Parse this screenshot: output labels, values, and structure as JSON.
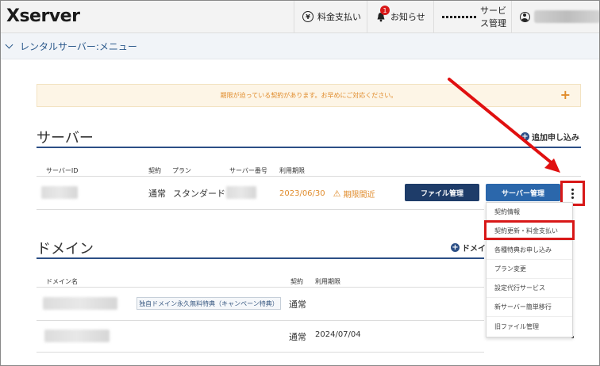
{
  "header": {
    "logo": "Xserver",
    "billing": "料金支払い",
    "notifications": "お知らせ",
    "notifications_badge": "1",
    "services": "サービス管理"
  },
  "menubar": {
    "label": "レンタルサーバー:メニュー"
  },
  "notice": {
    "text": "期限が迫っている契約があります。お早めにご対応ください。",
    "plus": "+"
  },
  "server": {
    "title": "サーバー",
    "add_link": "追加申し込み",
    "columns": [
      "サーバーID",
      "契約",
      "プラン",
      "サーバー番号",
      "利用期限"
    ],
    "row": {
      "contract": "通常",
      "plan": "スタンダード",
      "date": "2023/06/30",
      "warning": "期限間近",
      "file_btn": "ファイル管理",
      "server_btn": "サーバー管理"
    }
  },
  "dropdown": {
    "items": [
      "契約情報",
      "契約更新・料金支払い",
      "各種特典お申し込み",
      "プラン変更",
      "設定代行サービス",
      "新サーバー簡単移行",
      "旧ファイル管理"
    ]
  },
  "domain": {
    "title": "ドメイン",
    "add_link": "ドメイ",
    "columns": [
      "ドメイン名",
      "契約",
      "利用期限"
    ],
    "rows": [
      {
        "tag": "独自ドメイン永久無料特典（キャンペーン特典）",
        "contract": "通常",
        "date": ""
      },
      {
        "contract": "通常",
        "date": "2024/07/04"
      }
    ]
  },
  "colors": {
    "accent": "#2c4f86",
    "warning": "#e08b2b",
    "highlight": "#d81818"
  }
}
